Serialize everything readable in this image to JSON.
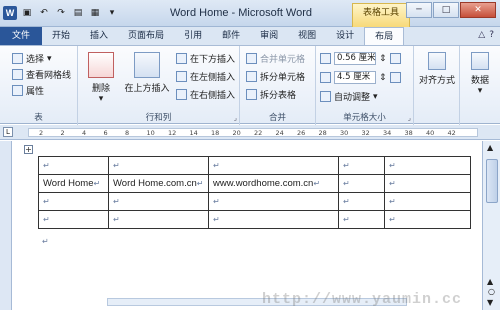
{
  "window": {
    "title": "Word Home - Microsoft Word",
    "context_tab": "表格工具"
  },
  "qat": {
    "icons": [
      "word-logo-icon",
      "save-icon",
      "undo-icon",
      "redo-icon",
      "new-doc-icon",
      "open-icon",
      "dropdown-icon"
    ]
  },
  "tabs": [
    {
      "label": "文件"
    },
    {
      "label": "开始"
    },
    {
      "label": "插入"
    },
    {
      "label": "页面布局"
    },
    {
      "label": "引用"
    },
    {
      "label": "邮件"
    },
    {
      "label": "审阅"
    },
    {
      "label": "视图"
    },
    {
      "label": "设计"
    },
    {
      "label": "布局"
    }
  ],
  "active_tab": "布局",
  "ribbon": {
    "table_group": {
      "label": "表",
      "select": "选择",
      "gridlines": "查看网格线",
      "properties": "属性"
    },
    "rowcol_group": {
      "label": "行和列",
      "delete": "删除",
      "insert_above": "在上方插入",
      "insert_below": "在下方插入",
      "insert_left": "在左侧插入",
      "insert_right": "在右侧插入"
    },
    "merge_group": {
      "label": "合并",
      "merge": "合并单元格",
      "split_cells": "拆分单元格",
      "split_table": "拆分表格"
    },
    "size_group": {
      "label": "单元格大小",
      "height": "0.56 厘米",
      "width": "4.5 厘米",
      "autofit": "自动调整"
    },
    "align": {
      "label": "对齐方式"
    },
    "data": {
      "label": "数据"
    }
  },
  "ruler": {
    "ticks": [
      "2",
      "2",
      "4",
      "6",
      "8",
      "10",
      "12",
      "14",
      "18",
      "20",
      "22",
      "24",
      "26",
      "28",
      "30",
      "32",
      "34",
      "38",
      "40",
      "42"
    ]
  },
  "table": {
    "rows": [
      [
        "",
        "",
        "",
        "",
        ""
      ],
      [
        "Word Home",
        "Word Home.com.cn",
        "www.wordhome.com.cn",
        "",
        ""
      ],
      [
        "",
        "",
        "",
        "",
        ""
      ],
      [
        "",
        "",
        "",
        "",
        ""
      ]
    ]
  },
  "watermark": "http://www.yaumin.cc",
  "colors": {
    "file_tab": "#2a5699",
    "context_tab": "#f7d979"
  }
}
